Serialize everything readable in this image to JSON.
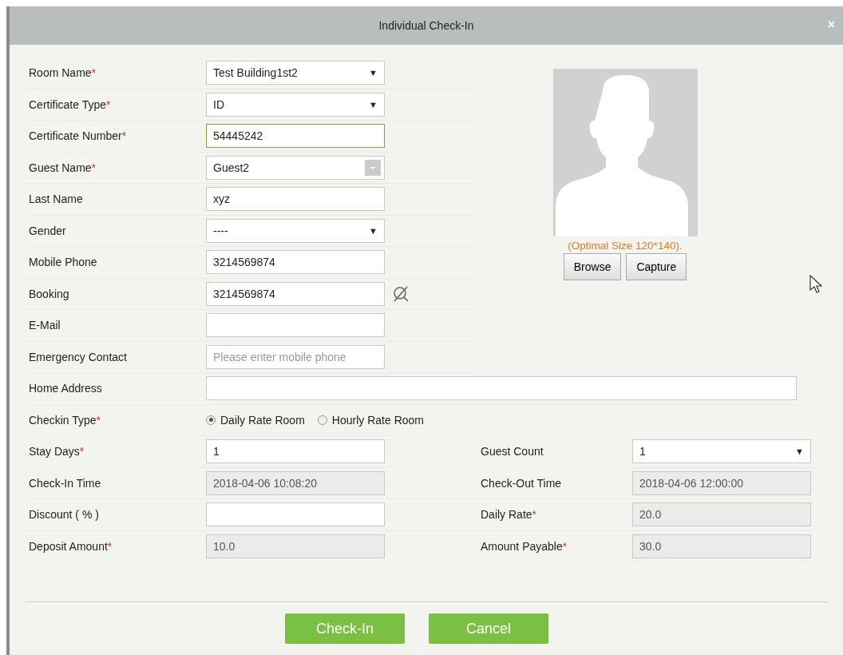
{
  "dialog": {
    "title": "Individual Check-In",
    "close": "×"
  },
  "fields": [
    {
      "label": "Room Name",
      "mark": "*",
      "kind": "select",
      "value": "Test Building1st2",
      "caret": "▼"
    },
    {
      "label": "Certificate Type",
      "mark": "*",
      "kind": "select",
      "value": "ID",
      "caret": "▼"
    },
    {
      "label": "Certificate Number",
      "mark": "*",
      "kind": "text",
      "value": "54445242",
      "focused": true
    },
    {
      "label": "Guest Name",
      "mark": "*",
      "kind": "combo",
      "value": "Guest2"
    },
    {
      "label": "Last Name",
      "kind": "text",
      "value": "xyz",
      "focused": false
    },
    {
      "label": "Gender",
      "kind": "select",
      "value": "----",
      "caret": "▼"
    },
    {
      "label": "Mobile Phone",
      "kind": "text",
      "value": "3214569874",
      "focused": false
    },
    {
      "label": "Booking",
      "kind": "lookup",
      "value": "3214569874"
    },
    {
      "label": "E-Mail",
      "kind": "text",
      "focused": false
    },
    {
      "label": "Emergency Contact",
      "kind": "text",
      "placeholder": "Please enter mobile phone",
      "focused": false
    }
  ],
  "photo": {
    "hint": "(Optimal Size 120*140).",
    "buttons": [
      "Browse",
      "Capture"
    ]
  },
  "home_address": {
    "label": "Home Address"
  },
  "checkin_type": {
    "label": "Checkin Type",
    "mark": "*",
    "options": [
      {
        "label": "Daily Rate Room",
        "selected": true
      },
      {
        "label": "Hourly Rate Room",
        "selected": false
      }
    ]
  },
  "pairs": [
    {
      "left": {
        "label": "Stay Days",
        "mark": "*",
        "kind": "text",
        "value": "1"
      },
      "right": {
        "label": "Guest Count",
        "kind": "select",
        "value": "1",
        "caret": "▼"
      }
    },
    {
      "left": {
        "label": "Check-In Time",
        "kind": "readonly",
        "value": "2018-04-06 10:08:20"
      },
      "right": {
        "label": "Check-Out Time",
        "kind": "readonly",
        "value": "2018-04-06 12:00:00"
      }
    },
    {
      "left": {
        "label": "Discount ( % )",
        "kind": "text"
      },
      "right": {
        "label": "Daily Rate",
        "mark": "*",
        "kind": "readonly",
        "value": "20.0"
      }
    },
    {
      "left": {
        "label": "Deposit Amount",
        "mark": "*",
        "kind": "readonly",
        "value": "10.0"
      },
      "right": {
        "label": "Amount Payable",
        "mark": "*",
        "kind": "readonly",
        "value": "30.0"
      }
    }
  ],
  "buttons": [
    "Check-In",
    "Cancel"
  ]
}
